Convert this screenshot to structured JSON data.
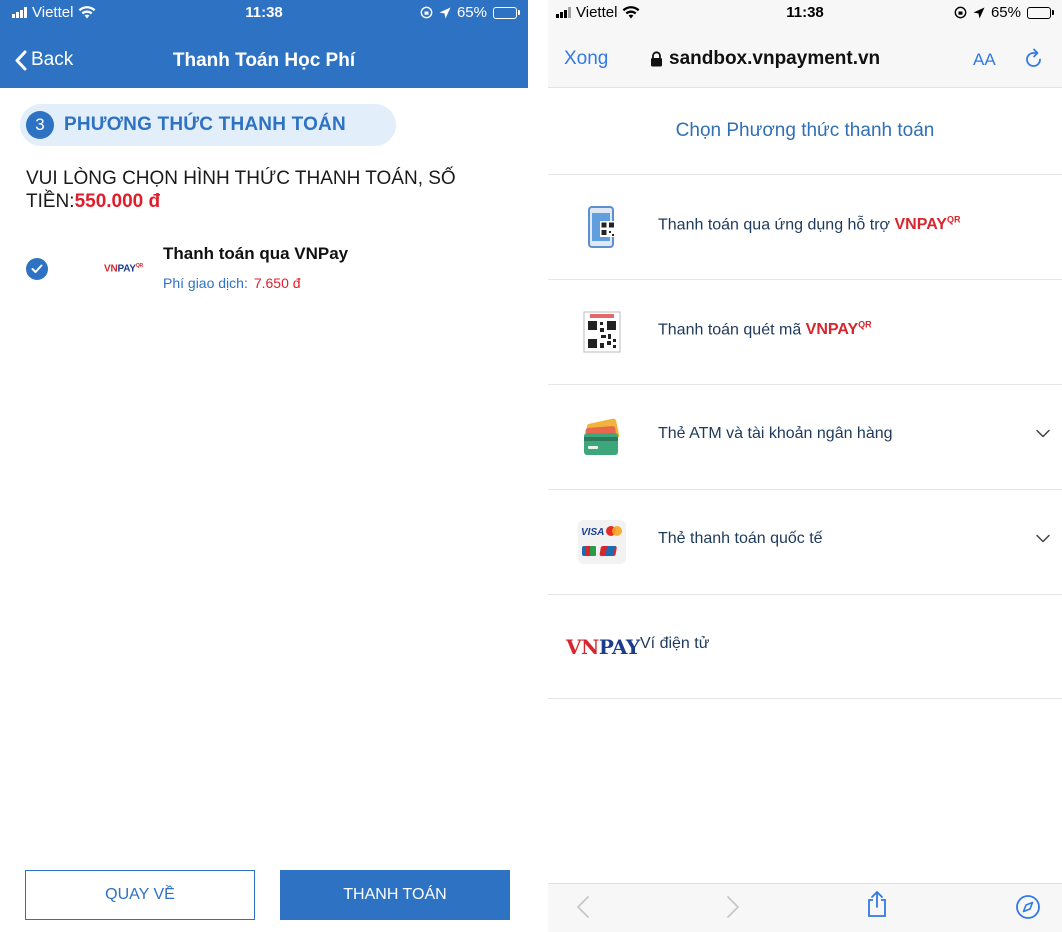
{
  "left": {
    "status": {
      "carrier": "Viettel",
      "time": "11:38",
      "battery": "65%"
    },
    "header": {
      "back_label": "Back",
      "title": "Thanh Toán Học Phí"
    },
    "step": {
      "number": "3",
      "label": "PHƯƠNG THỨC THANH TOÁN"
    },
    "prompt": {
      "text": "VUI LÒNG CHỌN HÌNH THỨC THANH TOÁN, SỐ TIỀN:",
      "amount": "550.000 đ"
    },
    "method": {
      "logo_text": "VNPAY",
      "name": "Thanh toán qua VNPay",
      "fee_label": "Phí giao dịch:",
      "fee_value": "7.650 đ",
      "selected": true
    },
    "buttons": {
      "back": "QUAY VỀ",
      "pay": "THANH TOÁN"
    },
    "colors": {
      "primary": "#2e72c3",
      "amount": "#e11d2a"
    }
  },
  "right": {
    "status": {
      "carrier": "Viettel",
      "time": "11:38",
      "battery": "65%"
    },
    "browser": {
      "done": "Xong",
      "url": "sandbox.vnpayment.vn",
      "text_size": "AA"
    },
    "title": "Chọn Phương thức thanh toán",
    "options": [
      {
        "icon": "phone-qr-icon",
        "label": "Thanh toán qua ứng dụng hỗ trợ",
        "brand": "VNPAY",
        "brand_sup": "QR",
        "expandable": false
      },
      {
        "icon": "qr-code-icon",
        "label": "Thanh toán quét mã",
        "brand": "VNPAY",
        "brand_sup": "QR",
        "expandable": false
      },
      {
        "icon": "atm-card-icon",
        "label": "Thẻ ATM và tài khoản ngân hàng",
        "expandable": true
      },
      {
        "icon": "intl-cards-icon",
        "label": "Thẻ thanh toán quốc tế",
        "expandable": true,
        "card_brands": [
          "VISA"
        ]
      },
      {
        "icon": "vnpay-wordmark",
        "logo_text": "VNPAY",
        "label": "Ví điện tử",
        "expandable": false
      }
    ],
    "colors": {
      "link": "#2f7ae5",
      "title": "#2f6fb5",
      "brand_red": "#d7262d",
      "brand_blue": "#1c3c8c"
    }
  }
}
